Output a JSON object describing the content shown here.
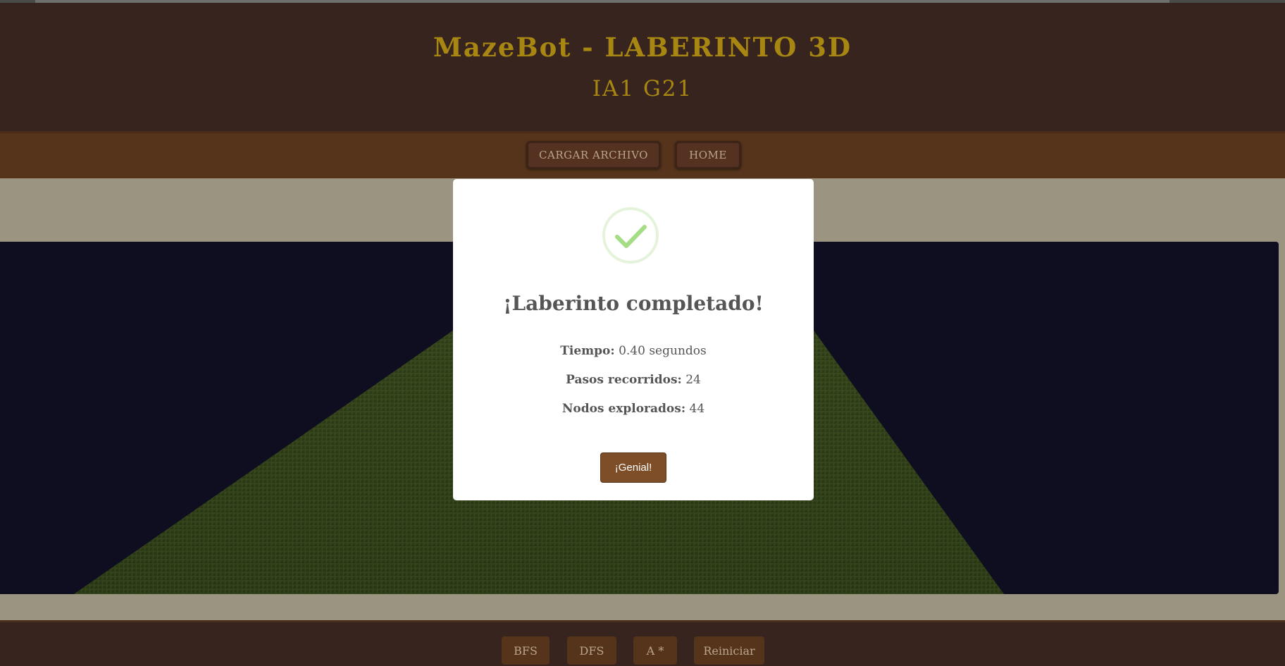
{
  "header": {
    "title": "MazeBot - LABERINTO 3D",
    "subtitle": "IA1 G21"
  },
  "nav": {
    "load_file": "CARGAR ARCHIVO",
    "home": "HOME"
  },
  "controls": {
    "bfs": "BFS",
    "dfs": "DFS",
    "astar": "A *",
    "restart": "Reiniciar"
  },
  "modal": {
    "title": "¡Laberinto completado!",
    "time_label": "Tiempo:",
    "time_value": "0.40 segundos",
    "steps_label": "Pasos recorridos:",
    "steps_value": "24",
    "nodes_label": "Nodos explorados:",
    "nodes_value": "44",
    "ok_label": "¡Genial!",
    "icon": "checkmark-icon"
  },
  "colors": {
    "header_bg": "#38241f",
    "title": "#a78712",
    "nav_bg": "#55341b",
    "button_text": "#b9a58c",
    "canvas_bg": "#0f0e20",
    "success_green": "#a5dc86",
    "modal_button": "#7d4e27"
  }
}
